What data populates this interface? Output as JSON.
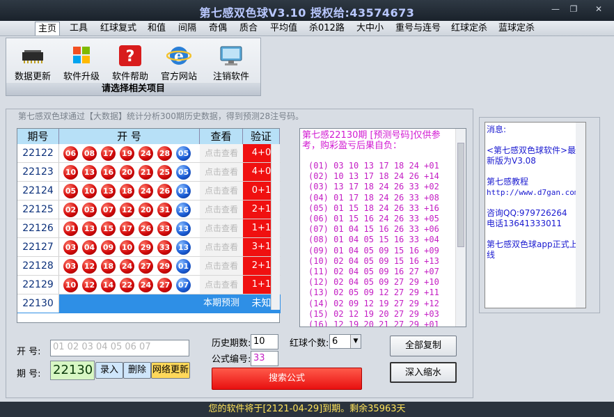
{
  "window": {
    "title": "第七感双色球V3.10  授权给:43574673",
    "min": "—",
    "max": "❐",
    "close": "✕"
  },
  "menu": [
    "主页",
    "工具",
    "红球复式",
    "和值",
    "间隔",
    "奇偶",
    "质合",
    "平均值",
    "杀012路",
    "大中小",
    "重号与连号",
    "红球定杀",
    "蓝球定杀"
  ],
  "toolbar": {
    "items": [
      {
        "label": "数据更新",
        "icon": "memory-chip-icon"
      },
      {
        "label": "软件升级",
        "icon": "windows-logo-icon"
      },
      {
        "label": "软件帮助",
        "icon": "help-icon"
      },
      {
        "label": "官方网站",
        "icon": "ie-browser-icon"
      },
      {
        "label": "注销软件",
        "icon": "monitor-icon"
      }
    ],
    "caption": "请选择相关项目"
  },
  "intro": "第七感双色球通过【大数据】统计分析300期历史数据，得到预测28注号码。",
  "grid": {
    "headers": [
      "期号",
      "开 号",
      "查看",
      "验证"
    ],
    "rows": [
      {
        "issue": "22122",
        "reds": [
          "06",
          "08",
          "17",
          "19",
          "24",
          "28"
        ],
        "blue": "05",
        "view": "点击查看",
        "verify": "4+0"
      },
      {
        "issue": "22123",
        "reds": [
          "10",
          "13",
          "16",
          "20",
          "21",
          "25"
        ],
        "blue": "05",
        "view": "点击查看",
        "verify": "4+0"
      },
      {
        "issue": "22124",
        "reds": [
          "05",
          "10",
          "13",
          "18",
          "24",
          "26"
        ],
        "blue": "01",
        "view": "点击查看",
        "verify": "0+1"
      },
      {
        "issue": "22125",
        "reds": [
          "02",
          "03",
          "07",
          "12",
          "20",
          "31"
        ],
        "blue": "16",
        "view": "点击查看",
        "verify": "2+1"
      },
      {
        "issue": "22126",
        "reds": [
          "01",
          "13",
          "15",
          "17",
          "26",
          "33"
        ],
        "blue": "13",
        "view": "点击查看",
        "verify": "1+1"
      },
      {
        "issue": "22127",
        "reds": [
          "03",
          "04",
          "09",
          "10",
          "29",
          "33"
        ],
        "blue": "13",
        "view": "点击查看",
        "verify": "3+1"
      },
      {
        "issue": "22128",
        "reds": [
          "03",
          "12",
          "18",
          "24",
          "27",
          "29"
        ],
        "blue": "01",
        "view": "点击查看",
        "verify": "2+1"
      },
      {
        "issue": "22129",
        "reds": [
          "10",
          "12",
          "14",
          "22",
          "24",
          "27"
        ],
        "blue": "07",
        "view": "点击查看",
        "verify": "1+1"
      }
    ],
    "current": {
      "issue": "22130",
      "view": "本期预测",
      "verify": "未知"
    }
  },
  "prediction": {
    "header": "第七感22130期 [预测号码]仅供参考，购彩盈亏后果自负：",
    "lines": [
      "(01) 03 10 13 17 18 24 +01",
      "(02) 10 13 17 18 24 26 +14",
      "(03) 13 17 18 24 26 33 +02",
      "(04) 01 17 18 24 26 33 +08",
      "(05) 01 15 18 24 26 33 +16",
      "(06) 01 15 16 24 26 33 +05",
      "(07) 01 04 15 16 26 33 +06",
      "(08) 01 04 05 15 16 33 +04",
      "(09) 01 04 05 09 15 16 +09",
      "(10) 02 04 05 09 15 16 +13",
      "(11) 02 04 05 09 16 27 +07",
      "(12) 02 04 05 09 27 29 +10",
      "(13) 02 05 09 12 27 29 +11",
      "(14) 02 09 12 19 27 29 +12",
      "(15) 02 12 19 20 27 29 +03",
      "(16) 12 19 20 21 27 29 +01",
      "(17) 12 19 20 21 22 29 +14"
    ]
  },
  "message": {
    "title": "消息:",
    "p1": "<第七感双色球软件>最新版为V3.08",
    "p2": "第七感教程",
    "link": "http://www.d7gan.com/",
    "p3": "咨询QQ:979726264",
    "p4": "电话13641333011",
    "p5": "第七感双色球app正式上线"
  },
  "form": {
    "open_label": "开  号:",
    "open_value": "01 02 03 04 05 06 07",
    "issue_label": "期  号:",
    "issue_value": "22130",
    "add": "录入",
    "delete": "删除",
    "net_update": "网络更新",
    "hist_label": "历史期数:",
    "hist_value": "10",
    "formula_label": "公式编号:",
    "formula_value": "33",
    "red_label": "红球个数:",
    "red_value": "6",
    "search": "搜索公式",
    "copy": "全部复制",
    "shrink": "深入缩水"
  },
  "status": "您的软件将于[2121-04-29]到期。剩余35963天",
  "colors": {
    "red_ball": "#d40b0b",
    "blue_ball": "#1c5fd8",
    "verify_bg": "#f01010",
    "current_row": "#2e8fe6",
    "pred_text": "#c41ec4"
  }
}
